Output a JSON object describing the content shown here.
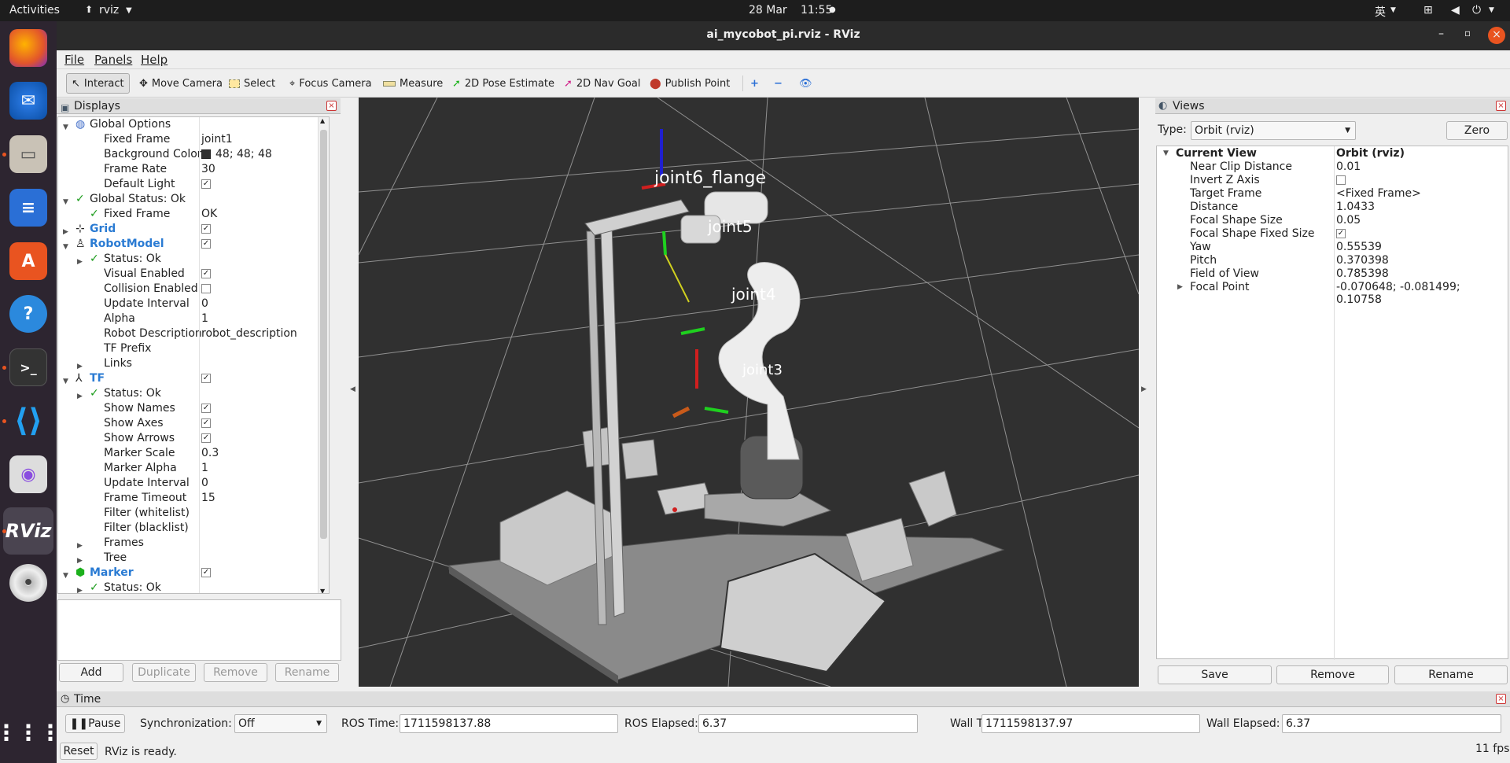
{
  "topbar": {
    "activities": "Activities",
    "app": "rviz",
    "date": "28 Mar",
    "time": "11:55",
    "ime": "英"
  },
  "window": {
    "title": "ai_mycobot_pi.rviz - RViz"
  },
  "menus": [
    "File",
    "Panels",
    "Help"
  ],
  "toolbar": {
    "interact": "Interact",
    "move_camera": "Move Camera",
    "select": "Select",
    "focus_camera": "Focus Camera",
    "measure": "Measure",
    "pose_estimate": "2D Pose Estimate",
    "nav_goal": "2D Nav Goal",
    "publish_point": "Publish Point"
  },
  "displays": {
    "title": "Displays",
    "rows": [
      {
        "label": "Global Options",
        "value": "",
        "level": 0,
        "arrow": "down",
        "icon": "globe-icon"
      },
      {
        "label": "Fixed Frame",
        "value": "joint1",
        "level": 1
      },
      {
        "label": "Background Color",
        "value": "48; 48; 48",
        "level": 1,
        "swatch": "#303030"
      },
      {
        "label": "Frame Rate",
        "value": "30",
        "level": 1
      },
      {
        "label": "Default Light",
        "value": "",
        "level": 1,
        "checkbox": true
      },
      {
        "label": "Global Status: Ok",
        "value": "",
        "level": 0,
        "arrow": "down",
        "icon": "check-icon"
      },
      {
        "label": "Fixed Frame",
        "value": "OK",
        "level": 1,
        "icon": "check-icon"
      },
      {
        "label": "Grid",
        "value": "",
        "level": 0,
        "arrow": "right",
        "icon": "grid-icon",
        "blue": true,
        "checkbox": true
      },
      {
        "label": "RobotModel",
        "value": "",
        "level": 0,
        "arrow": "down",
        "icon": "robot-icon",
        "blue": true,
        "checkbox": true
      },
      {
        "label": "Status: Ok",
        "value": "",
        "level": 1,
        "arrow": "right",
        "icon": "check-icon"
      },
      {
        "label": "Visual Enabled",
        "value": "",
        "level": 1,
        "checkbox": true
      },
      {
        "label": "Collision Enabled",
        "value": "",
        "level": 1,
        "checkbox": false
      },
      {
        "label": "Update Interval",
        "value": "0",
        "level": 1
      },
      {
        "label": "Alpha",
        "value": "1",
        "level": 1
      },
      {
        "label": "Robot Description",
        "value": "robot_description",
        "level": 1
      },
      {
        "label": "TF Prefix",
        "value": "",
        "level": 1
      },
      {
        "label": "Links",
        "value": "",
        "level": 1,
        "arrow": "right"
      },
      {
        "label": "TF",
        "value": "",
        "level": 0,
        "arrow": "down",
        "icon": "tf-icon",
        "blue": true,
        "checkbox": true
      },
      {
        "label": "Status: Ok",
        "value": "",
        "level": 1,
        "arrow": "right",
        "icon": "check-icon"
      },
      {
        "label": "Show Names",
        "value": "",
        "level": 1,
        "checkbox": true
      },
      {
        "label": "Show Axes",
        "value": "",
        "level": 1,
        "checkbox": true
      },
      {
        "label": "Show Arrows",
        "value": "",
        "level": 1,
        "checkbox": true
      },
      {
        "label": "Marker Scale",
        "value": "0.3",
        "level": 1
      },
      {
        "label": "Marker Alpha",
        "value": "1",
        "level": 1
      },
      {
        "label": "Update Interval",
        "value": "0",
        "level": 1
      },
      {
        "label": "Frame Timeout",
        "value": "15",
        "level": 1
      },
      {
        "label": "Filter (whitelist)",
        "value": "",
        "level": 1
      },
      {
        "label": "Filter (blacklist)",
        "value": "",
        "level": 1
      },
      {
        "label": "Frames",
        "value": "",
        "level": 1,
        "arrow": "right"
      },
      {
        "label": "Tree",
        "value": "",
        "level": 1,
        "arrow": "right"
      },
      {
        "label": "Marker",
        "value": "",
        "level": 0,
        "arrow": "down",
        "icon": "cube-icon",
        "blue": true,
        "checkbox": true
      },
      {
        "label": "Status: Ok",
        "value": "",
        "level": 1,
        "arrow": "right",
        "icon": "check-icon"
      }
    ],
    "buttons": {
      "add": "Add",
      "duplicate": "Duplicate",
      "remove": "Remove",
      "rename": "Rename"
    }
  },
  "viewport": {
    "labels": {
      "joint6": "joint6_flange",
      "joint5": "joint5",
      "joint4": "joint4",
      "joint3": "joint3"
    }
  },
  "views": {
    "title": "Views",
    "type_label": "Type:",
    "type_value": "Orbit (rviz)",
    "zero": "Zero",
    "current_view": "Current View",
    "current_view_value": "Orbit (rviz)",
    "props": [
      {
        "label": "Near Clip Distance",
        "value": "0.01"
      },
      {
        "label": "Invert Z Axis",
        "value": "",
        "checkbox": false
      },
      {
        "label": "Target Frame",
        "value": "<Fixed Frame>"
      },
      {
        "label": "Distance",
        "value": "1.0433"
      },
      {
        "label": "Focal Shape Size",
        "value": "0.05"
      },
      {
        "label": "Focal Shape Fixed Size",
        "value": "",
        "checkbox": true
      },
      {
        "label": "Yaw",
        "value": "0.55539"
      },
      {
        "label": "Pitch",
        "value": "0.370398"
      },
      {
        "label": "Field of View",
        "value": "0.785398"
      },
      {
        "label": "Focal Point",
        "value": "-0.070648; -0.081499; 0.10758",
        "arrow": "right"
      }
    ],
    "buttons": {
      "save": "Save",
      "remove": "Remove",
      "rename": "Rename"
    }
  },
  "time": {
    "title": "Time",
    "pause": "Pause",
    "sync_label": "Synchronization:",
    "sync_value": "Off",
    "ros_time_label": "ROS Time:",
    "ros_time": "1711598137.88",
    "ros_elapsed_label": "ROS Elapsed:",
    "ros_elapsed": "6.37",
    "wall_time_label": "Wall Time:",
    "wall_time": "1711598137.97",
    "wall_elapsed_label": "Wall Elapsed:",
    "wall_elapsed": "6.37"
  },
  "status": {
    "reset": "Reset",
    "message": "RViz is ready.",
    "fps": "11 fps"
  }
}
